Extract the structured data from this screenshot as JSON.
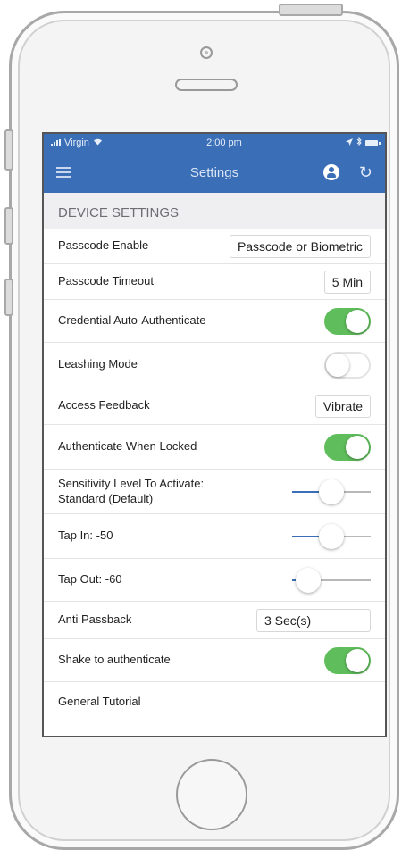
{
  "status_bar": {
    "carrier": "Virgin",
    "time": "2:00 pm",
    "wifi_icon": "wifi-icon",
    "location_icon": "location-arrow-icon",
    "bluetooth_icon": "bluetooth-icon",
    "battery_icon": "battery-icon"
  },
  "nav": {
    "title": "Settings",
    "menu_icon": "hamburger-menu-icon",
    "profile_icon": "profile-icon",
    "refresh_icon": "refresh-icon"
  },
  "section": {
    "header": "DEVICE SETTINGS"
  },
  "settings": {
    "passcode_enable": {
      "label": "Passcode Enable",
      "value": "Passcode or Biometric"
    },
    "passcode_timeout": {
      "label": "Passcode Timeout",
      "value": "5 Min"
    },
    "credential_auto": {
      "label": "Credential Auto-Authenticate",
      "enabled": true
    },
    "leashing_mode": {
      "label": "Leashing Mode",
      "enabled": false
    },
    "access_feedback": {
      "label": "Access Feedback",
      "value": "Vibrate"
    },
    "auth_when_locked": {
      "label": "Authenticate When Locked",
      "enabled": true
    },
    "sensitivity": {
      "label_line1": "Sensitivity Level To Activate:",
      "label_line2": "Standard (Default)",
      "level": 0.5
    },
    "tap_in": {
      "label": "Tap In: -50",
      "level": 0.5
    },
    "tap_out": {
      "label": "Tap Out: -60",
      "level": 0.2
    },
    "anti_passback": {
      "label": "Anti Passback",
      "value": "3 Sec(s)"
    },
    "shake": {
      "label": "Shake to authenticate",
      "enabled": true
    },
    "general_tutorial": {
      "label": "General Tutorial"
    }
  },
  "colors": {
    "nav_blue": "#3a6fb7",
    "toggle_green": "#5fbd5b"
  }
}
